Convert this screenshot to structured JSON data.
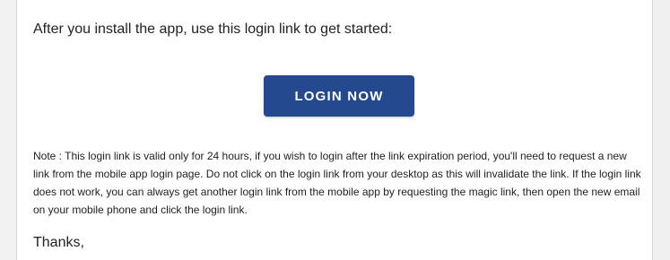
{
  "email": {
    "intro_text": "After you install the app, use this login link to get started:",
    "login_button_label": "LOGIN NOW",
    "note_text": "Note : This login link is valid only for 24 hours, if you wish to login after the link expiration period, you'll need to request a new link from the mobile app login page. Do not click on the login link from your desktop as this will invalidate the link. If the login link does not work, you can always get another login link from the mobile app by requesting the magic link, then open the new email on your mobile phone and click the login link.",
    "closing_text": "Thanks,"
  },
  "colors": {
    "button_background": "#24498f",
    "button_text": "#ffffff",
    "body_text": "#222222",
    "page_background": "#f2f2f2"
  }
}
